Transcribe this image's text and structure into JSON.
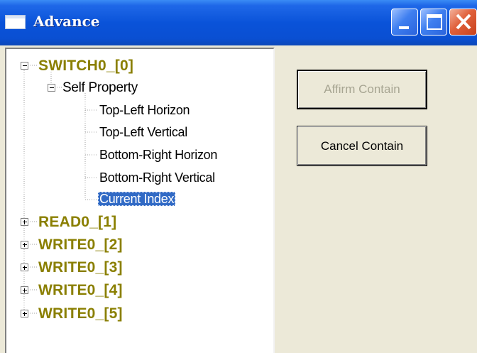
{
  "window": {
    "title": "Advance",
    "icon": "window-icon",
    "controls": {
      "minimize": "minimize-icon",
      "maximize": "maximize-icon",
      "close": "close-icon"
    }
  },
  "tree": {
    "root": {
      "label": "SWITCH0_[0]",
      "expanded": true
    },
    "group": {
      "label": "Self Property",
      "expanded": true
    },
    "properties": [
      {
        "label": "Top-Left Horizon"
      },
      {
        "label": "Top-Left Vertical"
      },
      {
        "label": "Bottom-Right Horizon"
      },
      {
        "label": "Bottom-Right Vertical"
      },
      {
        "label": "Current Index",
        "selected": true
      }
    ],
    "collapsed_nodes": [
      {
        "label": "READ0_[1]"
      },
      {
        "label": "WRITE0_[2]"
      },
      {
        "label": "WRITE0_[3]"
      },
      {
        "label": "WRITE0_[4]"
      },
      {
        "label": "WRITE0_[5]"
      }
    ],
    "colors": {
      "top_level_text": "#8a7f00",
      "selection_bg": "#316ac5"
    }
  },
  "buttons": {
    "affirm": {
      "label": "Affirm Contain",
      "enabled": false
    },
    "cancel": {
      "label": "Cancel Contain",
      "enabled": true
    }
  }
}
